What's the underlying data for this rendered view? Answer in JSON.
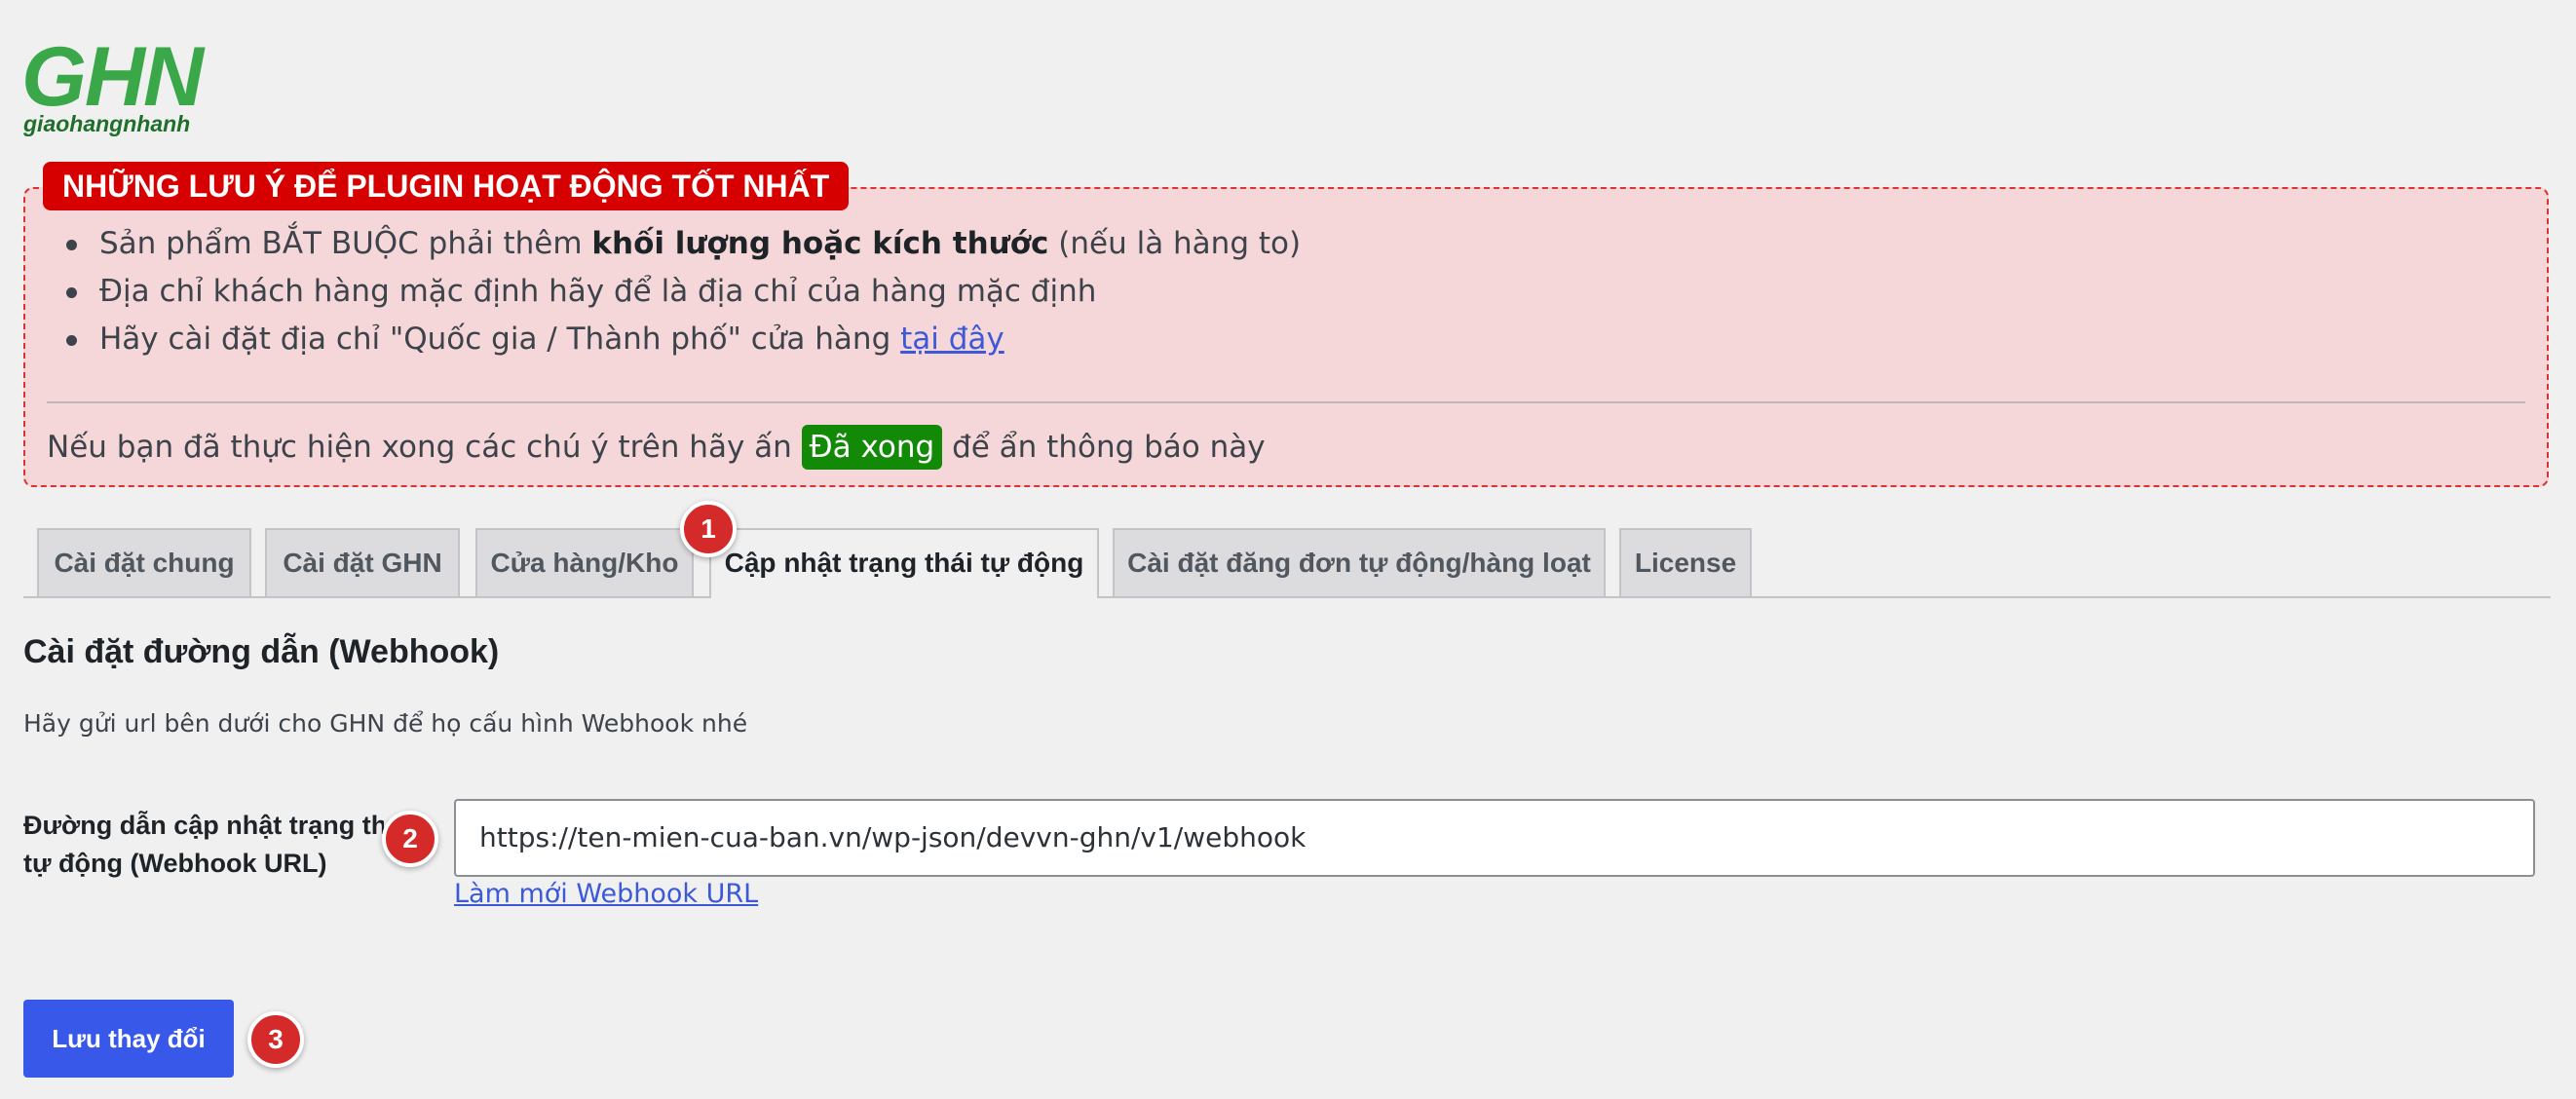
{
  "logo": {
    "text": "GHN",
    "subtext": "giaohangnhanh",
    "color": "#3aa848"
  },
  "notice": {
    "title": "NHỮNG LƯU Ý ĐỂ PLUGIN HOẠT ĐỘNG TỐT NHẤT",
    "items": [
      {
        "prefix": "Sản phẩm BẮT BUỘC phải thêm ",
        "bold": "khối lượng hoặc kích thước",
        "suffix": " (nếu là hàng to)"
      },
      {
        "text": "Địa chỉ khách hàng mặc định hãy để là địa chỉ của hàng mặc định"
      },
      {
        "prefix": "Hãy cài đặt địa chỉ \"Quốc gia / Thành phố\" cửa hàng ",
        "link": "tại đây"
      }
    ],
    "done_prefix": "Nếu bạn đã thực hiện xong các chú ý trên hãy ấn ",
    "done_button": "Đã xong",
    "done_suffix": " để ẩn thông báo này"
  },
  "tabs": [
    {
      "label": "Cài đặt chung"
    },
    {
      "label": "Cài đặt GHN"
    },
    {
      "label": "Cửa hàng/Kho"
    },
    {
      "label": "Cập nhật trạng thái tự động",
      "active": true
    },
    {
      "label": "Cài đặt đăng đơn tự động/hàng loạt"
    },
    {
      "label": "License"
    }
  ],
  "badges": [
    "1",
    "2",
    "3"
  ],
  "section": {
    "title": "Cài đặt đường dẫn (Webhook)",
    "description": "Hãy gửi url bên dưới cho GHN để họ cấu hình Webhook nhé",
    "field_label_line1": "Đường dẫn cập nhật trạng th",
    "field_label_line2": "tự động (Webhook URL)",
    "webhook_url": "https://ten-mien-cua-ban.vn/wp-json/devvn-ghn/v1/webhook",
    "refresh_link": "Làm mới Webhook URL"
  },
  "save_button": "Lưu thay đổi",
  "colors": {
    "notice_bg": "#f6d7d9",
    "notice_title": "#d60000",
    "done_badge": "#138a07",
    "primary": "#3858e9",
    "badge": "#d42a2a"
  }
}
